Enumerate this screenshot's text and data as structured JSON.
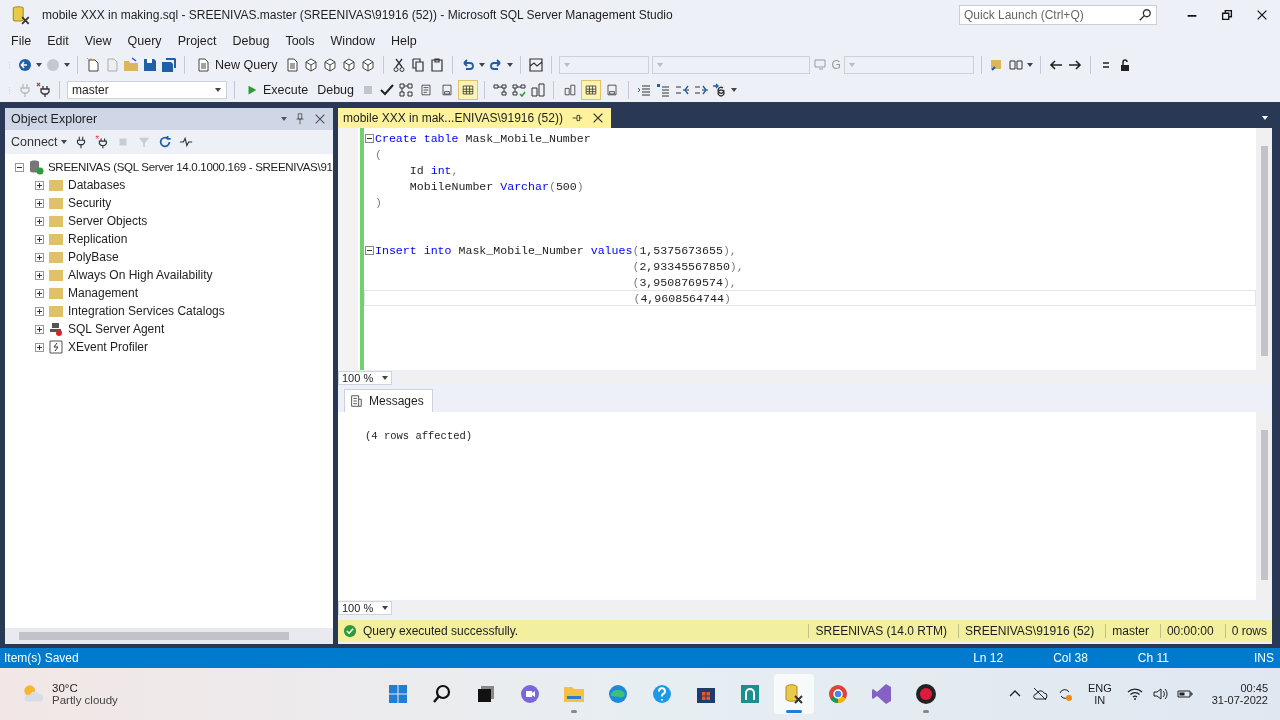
{
  "window": {
    "title": "mobile  XXX in making.sql - SREENIVAS.master (SREENIVAS\\91916 (52)) - Microsoft SQL Server Management Studio",
    "search": {
      "placeholder": "Quick Launch (Ctrl+Q)"
    }
  },
  "menu": [
    "File",
    "Edit",
    "View",
    "Query",
    "Project",
    "Debug",
    "Tools",
    "Window",
    "Help"
  ],
  "toolbar": {
    "new_query": "New Query",
    "find_label": "G",
    "database": "master",
    "execute": "Execute",
    "debug": "Debug",
    "result_modes": [
      {
        "selected": false
      },
      {
        "selected": false
      },
      {
        "selected": true
      }
    ],
    "query_options": [
      {
        "selected": false
      },
      {
        "selected": true
      },
      {
        "selected": false
      }
    ]
  },
  "object_explorer": {
    "title": "Object Explorer",
    "connect": "Connect",
    "tree": [
      {
        "label": "SREENIVAS (SQL Server 14.0.1000.169 - SREENIVAS\\91",
        "kind": "server",
        "expanded": true,
        "children": [
          {
            "label": "Databases",
            "kind": "folder",
            "expanded": false
          },
          {
            "label": "Security",
            "kind": "folder",
            "expanded": false
          },
          {
            "label": "Server Objects",
            "kind": "folder",
            "expanded": false
          },
          {
            "label": "Replication",
            "kind": "folder",
            "expanded": false
          },
          {
            "label": "PolyBase",
            "kind": "folder",
            "expanded": false
          },
          {
            "label": "Always On High Availability",
            "kind": "folder",
            "expanded": false
          },
          {
            "label": "Management",
            "kind": "folder",
            "expanded": false
          },
          {
            "label": "Integration Services Catalogs",
            "kind": "folder",
            "expanded": false
          },
          {
            "label": "SQL Server Agent",
            "kind": "agent",
            "expanded": false
          },
          {
            "label": "XEvent Profiler",
            "kind": "profiler",
            "expanded": false
          }
        ]
      }
    ]
  },
  "editor": {
    "tabs": [
      {
        "label": "mobile  XXX in mak...ENIVAS\\91916 (52))",
        "selected": true
      }
    ],
    "zoom": "100 %",
    "lines": [
      {
        "fold": true,
        "current": false,
        "segments": [
          {
            "kind": "keyword",
            "text": "Create table"
          },
          {
            "kind": "plain",
            "text": " Mask_Mobile_Number"
          }
        ]
      },
      {
        "fold": false,
        "current": false,
        "segments": [
          {
            "kind": "punct",
            "text": "("
          }
        ]
      },
      {
        "fold": false,
        "current": false,
        "segments": [
          {
            "kind": "plain",
            "text": "     Id "
          },
          {
            "kind": "keyword",
            "text": "int"
          },
          {
            "kind": "punct",
            "text": ","
          }
        ]
      },
      {
        "fold": false,
        "current": false,
        "segments": [
          {
            "kind": "plain",
            "text": "     MobileNumber "
          },
          {
            "kind": "keyword",
            "text": "Varchar"
          },
          {
            "kind": "punct",
            "text": "("
          },
          {
            "kind": "plain",
            "text": "500"
          },
          {
            "kind": "punct",
            "text": ")"
          }
        ]
      },
      {
        "fold": false,
        "current": false,
        "segments": [
          {
            "kind": "punct",
            "text": ")"
          }
        ]
      },
      {
        "fold": false,
        "current": false
      },
      {
        "fold": false,
        "current": false
      },
      {
        "fold": true,
        "current": false,
        "segments": [
          {
            "kind": "keyword",
            "text": "Insert into"
          },
          {
            "kind": "plain",
            "text": " Mask_Mobile_Number "
          },
          {
            "kind": "keyword",
            "text": "values"
          },
          {
            "kind": "punct",
            "text": "("
          },
          {
            "kind": "plain",
            "text": "1,5375673655"
          },
          {
            "kind": "punct",
            "text": "),"
          }
        ]
      },
      {
        "fold": false,
        "current": false,
        "segments": [
          {
            "kind": "punct",
            "text": "                                     ("
          },
          {
            "kind": "plain",
            "text": "2,93345567850"
          },
          {
            "kind": "punct",
            "text": "),"
          }
        ]
      },
      {
        "fold": false,
        "current": false,
        "segments": [
          {
            "kind": "punct",
            "text": "                                     ("
          },
          {
            "kind": "plain",
            "text": "3,9508769574"
          },
          {
            "kind": "punct",
            "text": "),"
          }
        ]
      },
      {
        "fold": false,
        "current": true,
        "segments": [
          {
            "kind": "punct",
            "text": "                                     ("
          },
          {
            "kind": "plain",
            "text": "4,9608564744"
          },
          {
            "kind": "punct",
            "text": ")"
          }
        ]
      }
    ]
  },
  "results": {
    "tabs": [
      {
        "label": "Messages",
        "selected": true
      }
    ],
    "messages": [
      "(4 rows affected)"
    ],
    "zoom": "100 %"
  },
  "query_status": {
    "message": "Query executed successfully.",
    "fields": [
      "SREENIVAS (14.0 RTM)",
      "SREENIVAS\\91916 (52)",
      "master",
      "00:00:00",
      "0 rows"
    ]
  },
  "status_bar": {
    "message": "Item(s) Saved",
    "fields": [
      "Ln 12",
      "Col 38",
      "Ch 11",
      "INS"
    ]
  },
  "taskbar": {
    "weather": {
      "temperature": "30°C",
      "condition": "Partly cloudy"
    },
    "apps": [
      {
        "kind": "start",
        "selected": false,
        "running": false
      },
      {
        "kind": "search",
        "selected": false,
        "running": false
      },
      {
        "kind": "taskview",
        "selected": false,
        "running": false
      },
      {
        "kind": "chat",
        "selected": false,
        "running": false
      },
      {
        "kind": "files",
        "selected": false,
        "running": true
      },
      {
        "kind": "browser",
        "selected": false,
        "running": false
      },
      {
        "kind": "help",
        "selected": false,
        "running": false
      },
      {
        "kind": "store",
        "selected": false,
        "running": false
      },
      {
        "kind": "app",
        "selected": false,
        "running": false
      },
      {
        "kind": "ssms",
        "selected": true,
        "running": true
      },
      {
        "kind": "chrome",
        "selected": false,
        "running": false
      },
      {
        "kind": "studio",
        "selected": false,
        "running": false
      },
      {
        "kind": "recorder",
        "selected": false,
        "running": true
      }
    ],
    "language": "ENG",
    "region": "IN",
    "time": "00:45",
    "date": "31-07-2022"
  }
}
